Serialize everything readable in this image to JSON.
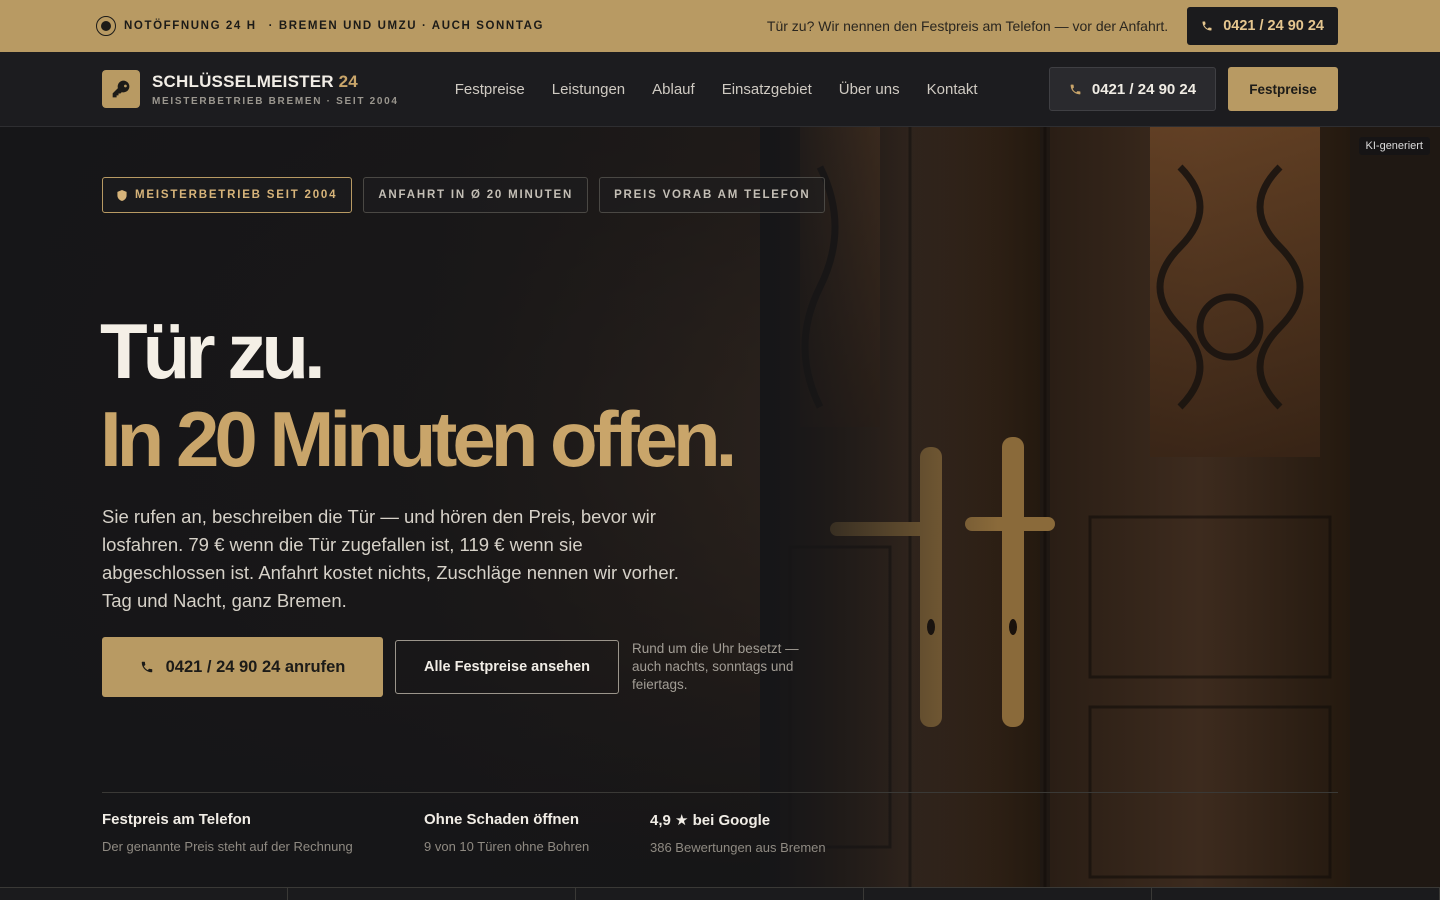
{
  "topbar": {
    "emergency": "NOTÖFFNUNG 24 H",
    "region": "· BREMEN UND UMZU · AUCH SONNTAG",
    "notice": "Tür zu? Wir nennen den Festpreis am Telefon — vor der Anfahrt.",
    "phone": "0421 / 24 90 24"
  },
  "nav": {
    "brand_name": "SCHLÜSSELMEISTER",
    "brand_num": "24",
    "brand_sub": "MEISTERBETRIEB BREMEN · SEIT 2004",
    "items": [
      "Festpreise",
      "Leistungen",
      "Ablauf",
      "Einsatzgebiet",
      "Über uns",
      "Kontakt"
    ],
    "phone": "0421 / 24 90 24",
    "cta": "Festpreise"
  },
  "hero": {
    "ai_tag": "KI-generiert",
    "badges": [
      "MEISTERBETRIEB SEIT 2004",
      "ANFAHRT IN Ø 20 MINUTEN",
      "PREIS VORAB AM TELEFON"
    ],
    "headline_1": "Tür zu.",
    "headline_2": "In 20 Minuten offen.",
    "lead": "Sie rufen an, beschreiben die Tür — und hören den Preis, bevor wir losfahren. 79 € wenn die Tür zugefallen ist, 119 € wenn sie abgeschlossen ist. Anfahrt kostet nichts, Zuschläge nennen wir vorher. Tag und Nacht, ganz Bremen.",
    "cta_main": "0421 / 24 90 24 anrufen",
    "cta_secondary": "Alle Festpreise ansehen",
    "cta_note": "Rund um die Uhr besetzt — auch nachts, sonntags und feiertags."
  },
  "features": [
    {
      "title": "Festpreis am Telefon",
      "sub": "Der genannte Preis steht auf der Rechnung"
    },
    {
      "title": "Ohne Schaden öffnen",
      "sub": "9 von 10 Türen ohne Bohren"
    },
    {
      "title": "4,9 ★ bei Google",
      "sub": "386 Bewertungen aus Bremen"
    }
  ],
  "colors": {
    "accent": "#b89a63",
    "accent_text": "#c9a56a",
    "dark": "#1c1c1f"
  }
}
